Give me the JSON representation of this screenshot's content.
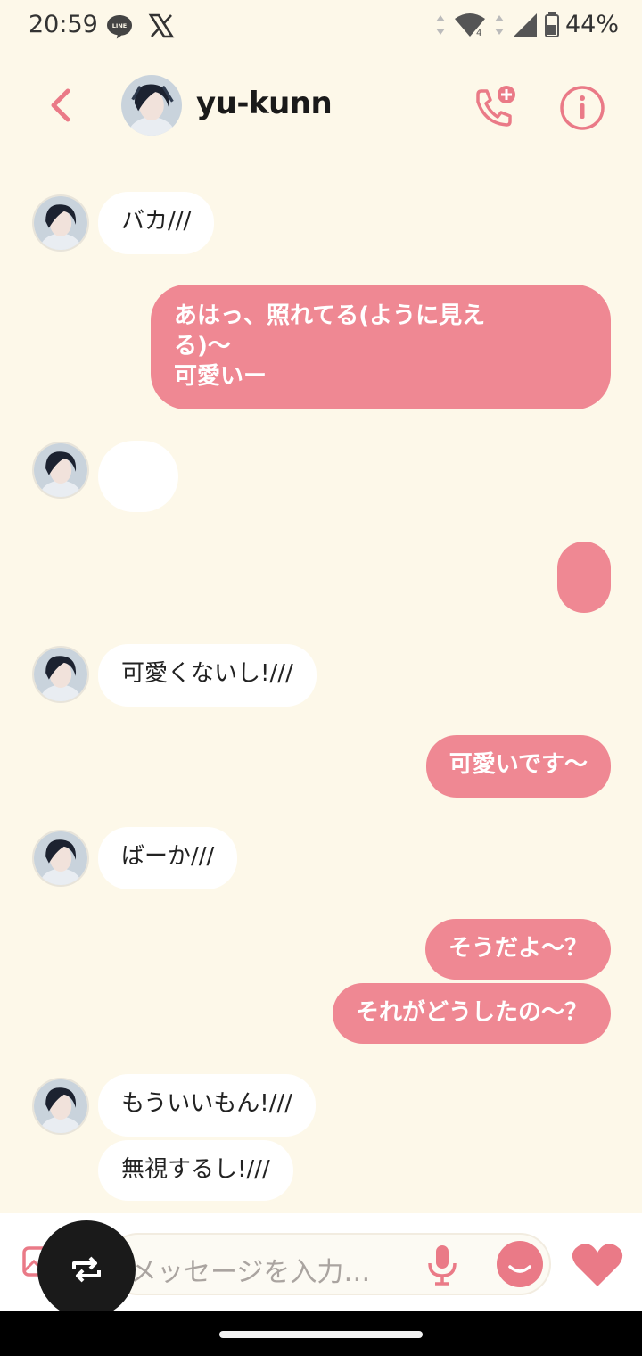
{
  "status": {
    "time": "20:59",
    "battery": "44%",
    "network": "4"
  },
  "header": {
    "title": "yu-kunn"
  },
  "messages": [
    {
      "side": "in",
      "text": "バカ///"
    },
    {
      "side": "out",
      "line1": "あはっ、照れてる(ように見え",
      "line2": "る)〜",
      "line3": "可愛いー"
    },
    {
      "side": "in",
      "text": ""
    },
    {
      "side": "out",
      "text": ""
    },
    {
      "side": "in",
      "text": "可愛くないし!///"
    },
    {
      "side": "out",
      "text": "可愛いです〜"
    },
    {
      "side": "in",
      "text": "ばーか///"
    },
    {
      "side": "out",
      "text": "そうだよ〜？"
    },
    {
      "side": "out",
      "text": "それがどうしたの〜？"
    },
    {
      "side": "in",
      "text": "もういいもん!///"
    },
    {
      "side": "in",
      "text": "無視するし!///"
    }
  ],
  "input": {
    "placeholder": "メッセージを入力…"
  },
  "icons": {
    "back": "chevron-left-icon",
    "call": "add-call-icon",
    "info": "info-icon",
    "image": "image-icon",
    "mic": "microphone-icon",
    "emoji": "smile-icon",
    "like": "heart-icon",
    "floating": "repeat-icon"
  },
  "colors": {
    "accent": "#ef8893",
    "background": "#fdf8e9",
    "bubble_in": "#ffffff"
  }
}
